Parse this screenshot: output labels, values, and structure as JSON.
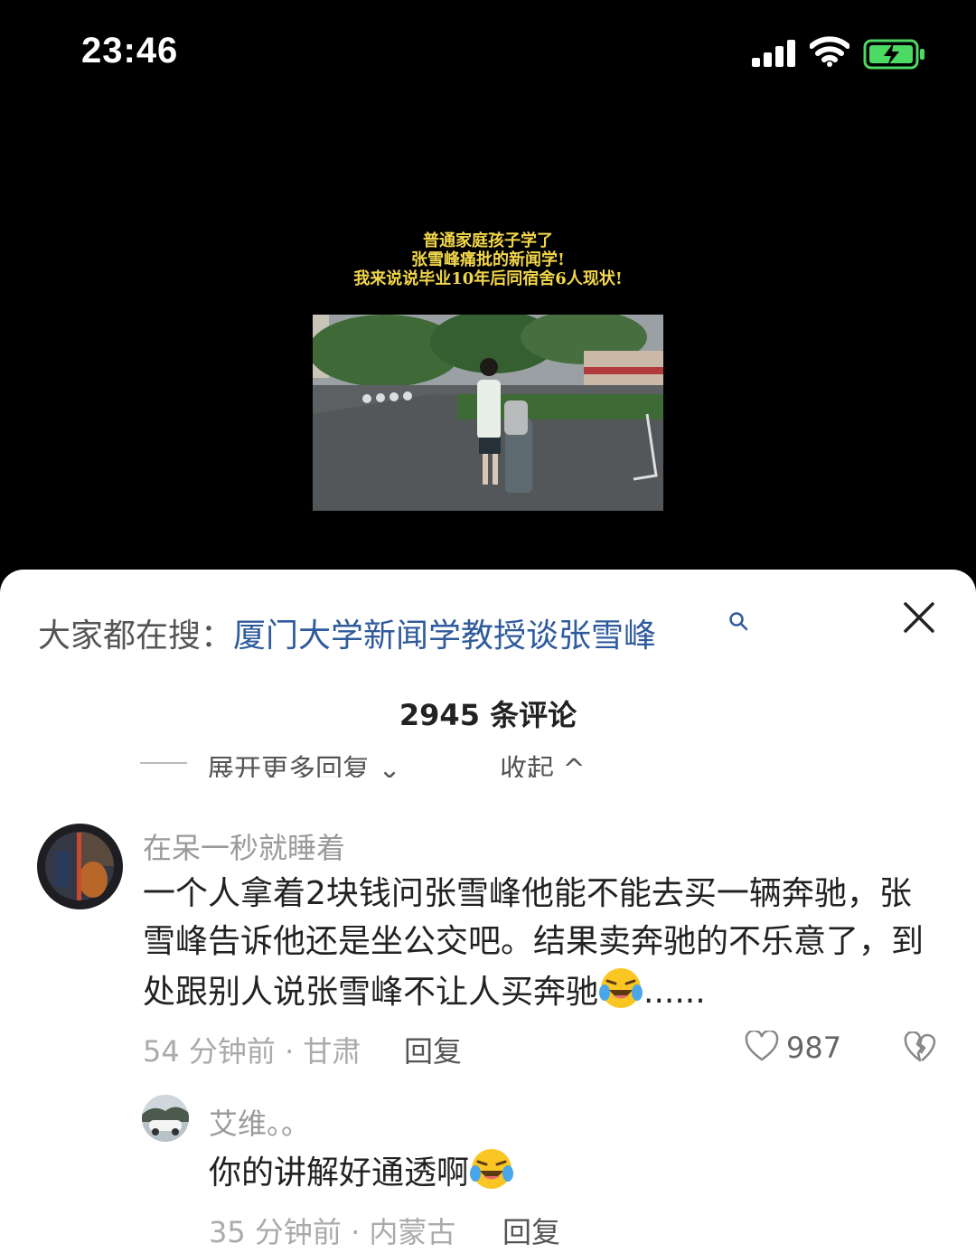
{
  "status_bar": {
    "time": "23:46",
    "icons": [
      "cellular-signal-icon",
      "wifi-icon",
      "battery-charging-icon"
    ],
    "battery_color": "#4cd964"
  },
  "video": {
    "caption_lines": [
      "普通家庭孩子学了",
      "张雪峰痛批的新闻学!",
      "我来说说毕业10年后同宿舍6人现状!"
    ],
    "caption_color": "#f2d64b"
  },
  "search_bar": {
    "prefix": "大家都在搜：",
    "query": "厦门大学新闻学教授谈张雪峰",
    "link_color": "#2f5b9c"
  },
  "comments_header": {
    "title": "2945 条评论"
  },
  "thread_controls": {
    "expand_label": "展开更多回复",
    "collapse_label": "收起"
  },
  "comments": [
    {
      "username": "在呆一秒就睡着",
      "text": "一个人拿着2块钱问张雪峰他能不能去买一辆奔驰，张雪峰告诉他还是坐公交吧。结果卖奔驰的不乐意了，到处跟别人说张雪峰不让人买奔驰",
      "emoji": "laughing-crying-emoji",
      "ellipsis": "......",
      "meta": "54 分钟前 · 甘肃",
      "reply_label": "回复",
      "likes": "987",
      "reply": {
        "username": "艾维。。",
        "text": "你的讲解好通透啊",
        "emoji": "laughing-crying-emoji",
        "meta": "35 分钟前 · 内蒙古",
        "reply_label": "回复"
      }
    }
  ]
}
